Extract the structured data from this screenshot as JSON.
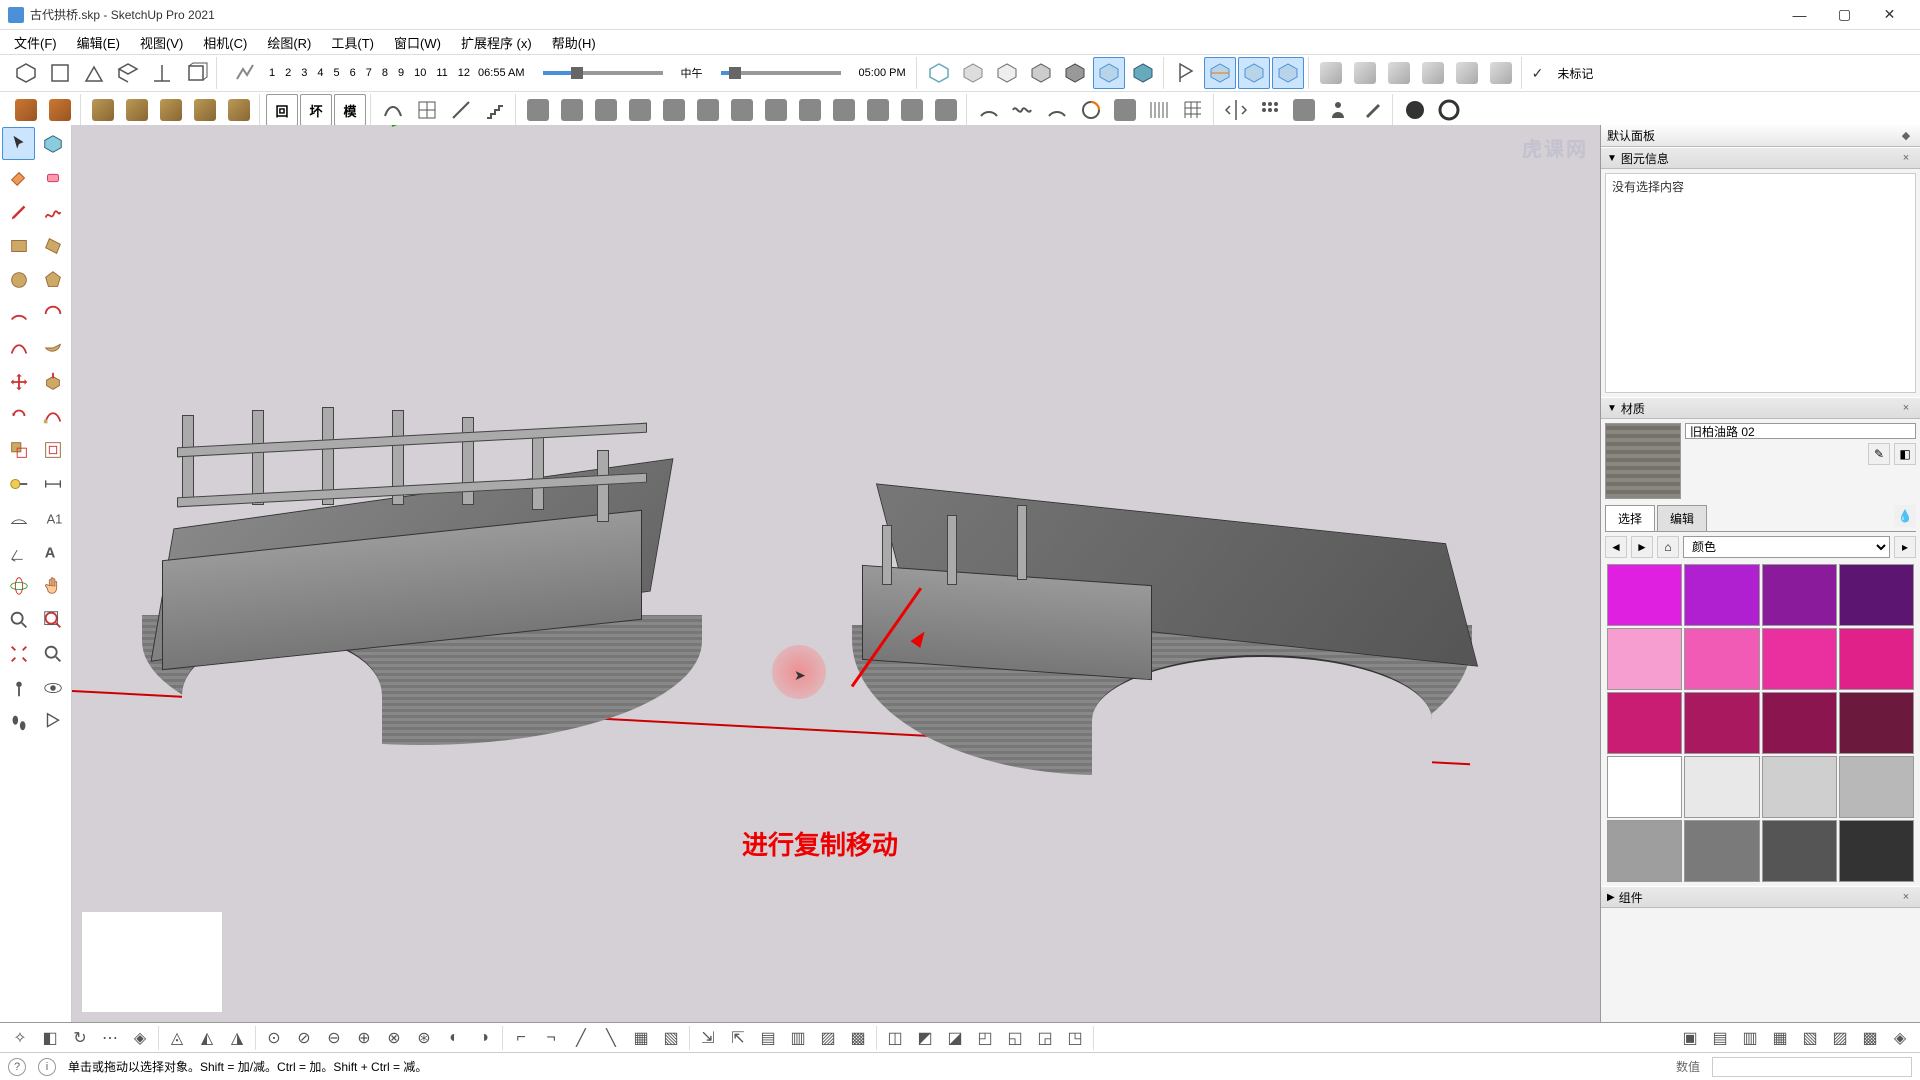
{
  "titlebar": {
    "filename": "古代拱桥.skp",
    "app": "SketchUp Pro 2021"
  },
  "menu": [
    "文件(F)",
    "编辑(E)",
    "视图(V)",
    "相机(C)",
    "绘图(R)",
    "工具(T)",
    "窗口(W)",
    "扩展程序 (x)",
    "帮助(H)"
  ],
  "time": {
    "ticks": [
      "1",
      "2",
      "3",
      "4",
      "5",
      "6",
      "7",
      "8",
      "9",
      "10",
      "11",
      "12"
    ],
    "am": "06:55 AM",
    "noon": "中午",
    "pm": "05:00 PM"
  },
  "tag": {
    "untagged": "未标记"
  },
  "right_panel": {
    "default_panel": "默认面板",
    "entity_info": "图元信息",
    "entity_empty": "没有选择内容",
    "materials": "材质",
    "material_name": "旧柏油路 02",
    "tab_select": "选择",
    "tab_edit": "编辑",
    "dropdown": "颜色",
    "components": "组件"
  },
  "colors": [
    "#e020e0",
    "#b020d0",
    "#8a1c9c",
    "#5c1570",
    "#f59ecf",
    "#f25bb5",
    "#ea2f9e",
    "#e0218a",
    "#c91d73",
    "#a81960",
    "#8a154f",
    "#6b1a3e",
    "#ffffff",
    "#e8e8e8",
    "#cfcfcf",
    "#b8b8b8",
    "#9e9e9e",
    "#7a7a7a",
    "#555555",
    "#333333"
  ],
  "annotation": {
    "text": "进行复制移动"
  },
  "watermark": "虎课网",
  "statusbar": {
    "hint": "单击或拖动以选择对象。Shift = 加/减。Ctrl = 加。Shift + Ctrl = 减。",
    "value_label": "数值"
  }
}
